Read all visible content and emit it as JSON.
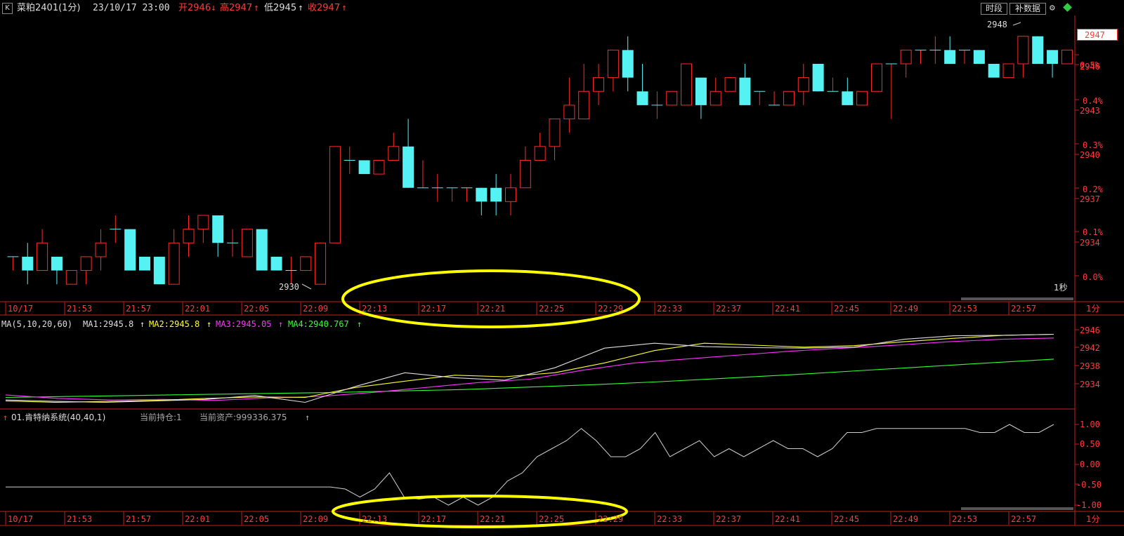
{
  "header": {
    "k_button": "K",
    "symbol": "菜粕2401(1分)",
    "datetime": "23/10/17  23:00",
    "open": "开2946",
    "open_arrow": "↓",
    "high": "高2947",
    "high_arrow": "↑",
    "low": "低2945",
    "low_arrow": "↑",
    "close": "收2947",
    "close_arrow": "↑",
    "btn_period": "时段",
    "btn_fill": "补数据"
  },
  "price_axis": {
    "price_ticks": [
      "2946",
      "2943",
      "2940",
      "2937",
      "2934"
    ],
    "pct_ticks": [
      "0.5%",
      "0.4%",
      "0.3%",
      "0.2%",
      "0.1%",
      "0.0%"
    ],
    "current_price": "2947"
  },
  "annotations": {
    "high_mark": "2948",
    "low_mark": "2930",
    "timeframe": "1秒"
  },
  "time_axis": {
    "labels": [
      "10/17",
      "21:53",
      "21:57",
      "22:01",
      "22:05",
      "22:09",
      "22:13",
      "22:17",
      "22:21",
      "22:25",
      "22:29",
      "22:33",
      "22:37",
      "22:41",
      "22:45",
      "22:49",
      "22:53",
      "22:57"
    ],
    "unit": "1分"
  },
  "ma_panel": {
    "name": "MA(5,10,20,60)",
    "ma1": "MA1:2945.8",
    "ma2": "MA2:2945.8",
    "ma3": "MA3:2945.05",
    "ma4": "MA4:2940.767",
    "arrow": "↑",
    "ticks": [
      "2946",
      "2942",
      "2938",
      "2934"
    ],
    "colors": {
      "ma1": "#dedede",
      "ma2": "#ffff33",
      "ma3": "#ff33ff",
      "ma4": "#33ff33"
    }
  },
  "system_panel": {
    "arrow": "↑",
    "name": "01.肯特纳系统(40,40,1)",
    "position": "当前持仓:1",
    "assets": "当前资产:999336.375",
    "ticks": [
      "1.00",
      "0.50",
      "0.00",
      "-0.50",
      "-1.00"
    ]
  },
  "colors": {
    "up": "#ff2a2a",
    "down": "#55f2f4",
    "axis": "#c81e1e",
    "highlight": "#ffff00"
  },
  "chart_data": {
    "type": "candlestick",
    "y_range": [
      2929.5,
      2948.8
    ],
    "candles": [
      {
        "o": 2932,
        "h": 2932,
        "l": 2931,
        "c": 2932
      },
      {
        "o": 2932,
        "h": 2933,
        "l": 2930,
        "c": 2931
      },
      {
        "o": 2931,
        "h": 2934,
        "l": 2931,
        "c": 2933
      },
      {
        "o": 2932,
        "h": 2932,
        "l": 2930,
        "c": 2931
      },
      {
        "o": 2930,
        "h": 2931,
        "l": 2930,
        "c": 2931
      },
      {
        "o": 2931,
        "h": 2932,
        "l": 2930,
        "c": 2932
      },
      {
        "o": 2932,
        "h": 2934,
        "l": 2931,
        "c": 2933
      },
      {
        "o": 2934,
        "h": 2935,
        "l": 2933,
        "c": 2934
      },
      {
        "o": 2934,
        "h": 2934,
        "l": 2931,
        "c": 2931
      },
      {
        "o": 2932,
        "h": 2932,
        "l": 2931,
        "c": 2931
      },
      {
        "o": 2932,
        "h": 2932,
        "l": 2930,
        "c": 2930
      },
      {
        "o": 2930,
        "h": 2934,
        "l": 2930,
        "c": 2933
      },
      {
        "o": 2933,
        "h": 2935,
        "l": 2932,
        "c": 2934
      },
      {
        "o": 2934,
        "h": 2935,
        "l": 2933,
        "c": 2935
      },
      {
        "o": 2935,
        "h": 2935,
        "l": 2932,
        "c": 2933
      },
      {
        "o": 2933,
        "h": 2934,
        "l": 2932,
        "c": 2933
      },
      {
        "o": 2932,
        "h": 2934,
        "l": 2932,
        "c": 2934
      },
      {
        "o": 2934,
        "h": 2934,
        "l": 2931,
        "c": 2931
      },
      {
        "o": 2932,
        "h": 2932,
        "l": 2931,
        "c": 2931
      },
      {
        "o": 2931,
        "h": 2932,
        "l": 2930,
        "c": 2931
      },
      {
        "o": 2931,
        "h": 2932,
        "l": 2931,
        "c": 2932
      },
      {
        "o": 2930,
        "h": 2933,
        "l": 2930,
        "c": 2933
      },
      {
        "o": 2933,
        "h": 2940,
        "l": 2933,
        "c": 2940
      },
      {
        "o": 2939,
        "h": 2940,
        "l": 2938,
        "c": 2939
      },
      {
        "o": 2939,
        "h": 2939,
        "l": 2938,
        "c": 2938
      },
      {
        "o": 2938,
        "h": 2939,
        "l": 2938,
        "c": 2939
      },
      {
        "o": 2939,
        "h": 2941,
        "l": 2939,
        "c": 2940
      },
      {
        "o": 2940,
        "h": 2942,
        "l": 2937,
        "c": 2937
      },
      {
        "o": 2937,
        "h": 2939,
        "l": 2937,
        "c": 2937
      },
      {
        "o": 2937,
        "h": 2938,
        "l": 2936,
        "c": 2937
      },
      {
        "o": 2937,
        "h": 2937,
        "l": 2936,
        "c": 2937
      },
      {
        "o": 2937,
        "h": 2937,
        "l": 2936,
        "c": 2937
      },
      {
        "o": 2937,
        "h": 2937,
        "l": 2935,
        "c": 2936
      },
      {
        "o": 2937,
        "h": 2938,
        "l": 2935,
        "c": 2936
      },
      {
        "o": 2936,
        "h": 2938,
        "l": 2935,
        "c": 2937
      },
      {
        "o": 2937,
        "h": 2940,
        "l": 2937,
        "c": 2939
      },
      {
        "o": 2939,
        "h": 2941,
        "l": 2939,
        "c": 2940
      },
      {
        "o": 2940,
        "h": 2942,
        "l": 2939,
        "c": 2942
      },
      {
        "o": 2942,
        "h": 2945,
        "l": 2941,
        "c": 2943
      },
      {
        "o": 2942,
        "h": 2946,
        "l": 2942,
        "c": 2944
      },
      {
        "o": 2944,
        "h": 2946,
        "l": 2943,
        "c": 2945
      },
      {
        "o": 2945,
        "h": 2947,
        "l": 2944,
        "c": 2947
      },
      {
        "o": 2947,
        "h": 2948,
        "l": 2944,
        "c": 2945
      },
      {
        "o": 2944,
        "h": 2946,
        "l": 2943,
        "c": 2943
      },
      {
        "o": 2943,
        "h": 2944,
        "l": 2942,
        "c": 2943
      },
      {
        "o": 2943,
        "h": 2944,
        "l": 2943,
        "c": 2944
      },
      {
        "o": 2943,
        "h": 2946,
        "l": 2943,
        "c": 2946
      },
      {
        "o": 2945,
        "h": 2945,
        "l": 2942,
        "c": 2943
      },
      {
        "o": 2943,
        "h": 2945,
        "l": 2943,
        "c": 2944
      },
      {
        "o": 2944,
        "h": 2945,
        "l": 2944,
        "c": 2945
      },
      {
        "o": 2945,
        "h": 2946,
        "l": 2943,
        "c": 2943
      },
      {
        "o": 2944,
        "h": 2944,
        "l": 2943,
        "c": 2944
      },
      {
        "o": 2943,
        "h": 2944,
        "l": 2943,
        "c": 2943
      },
      {
        "o": 2943,
        "h": 2944,
        "l": 2943,
        "c": 2944
      },
      {
        "o": 2944,
        "h": 2946,
        "l": 2943,
        "c": 2945
      },
      {
        "o": 2946,
        "h": 2946,
        "l": 2944,
        "c": 2944
      },
      {
        "o": 2944,
        "h": 2945,
        "l": 2944,
        "c": 2944
      },
      {
        "o": 2944,
        "h": 2945,
        "l": 2943,
        "c": 2943
      },
      {
        "o": 2943,
        "h": 2944,
        "l": 2943,
        "c": 2944
      },
      {
        "o": 2944,
        "h": 2946,
        "l": 2944,
        "c": 2946
      },
      {
        "o": 2946,
        "h": 2946,
        "l": 2942,
        "c": 2946
      },
      {
        "o": 2946,
        "h": 2947,
        "l": 2945,
        "c": 2947
      },
      {
        "o": 2947,
        "h": 2947,
        "l": 2946,
        "c": 2947
      },
      {
        "o": 2947,
        "h": 2948,
        "l": 2946,
        "c": 2947
      },
      {
        "o": 2947,
        "h": 2948,
        "l": 2946,
        "c": 2946
      },
      {
        "o": 2947,
        "h": 2947,
        "l": 2946,
        "c": 2947
      },
      {
        "o": 2947,
        "h": 2947,
        "l": 2946,
        "c": 2946
      },
      {
        "o": 2946,
        "h": 2946,
        "l": 2945,
        "c": 2945
      },
      {
        "o": 2945,
        "h": 2946,
        "l": 2945,
        "c": 2946
      },
      {
        "o": 2946,
        "h": 2946,
        "l": 2945,
        "c": 2948
      },
      {
        "o": 2948,
        "h": 2948,
        "l": 2946,
        "c": 2946
      },
      {
        "o": 2947,
        "h": 2947,
        "l": 2945,
        "c": 2946
      },
      {
        "o": 2946,
        "h": 2947,
        "l": 2946,
        "c": 2947
      }
    ],
    "ma_y_range": [
      2931.5,
      2947.3
    ],
    "ma_series": [
      {
        "key": "ma4",
        "values": [
          2933.0,
          2933.2,
          2933.4,
          2933.6,
          2933.8,
          2934.0,
          2934.3,
          2934.6,
          2935.1,
          2935.6,
          2936.2,
          2936.9,
          2937.6,
          2938.4,
          2939.2,
          2940.0,
          2940.767
        ]
      },
      {
        "key": "ma3",
        "values": [
          2933.5,
          2932.8,
          2932.5,
          2932.6,
          2932.4,
          2932.9,
          2933.2,
          2934.0,
          2935.0,
          2936.0,
          2936.7,
          2938.5,
          2940.0,
          2940.8,
          2941.6,
          2942.4,
          2943.0,
          2943.6,
          2944.3,
          2944.8,
          2945.05
        ]
      },
      {
        "key": "ma2",
        "values": [
          2932.3,
          2932.0,
          2932.2,
          2932.4,
          2932.8,
          2933.1,
          2933.0,
          2935.0,
          2936.3,
          2937.5,
          2937.2,
          2938.0,
          2940.0,
          2942.5,
          2944.0,
          2943.6,
          2943.2,
          2943.5,
          2944.3,
          2945.0,
          2945.6,
          2945.8
        ]
      },
      {
        "key": "ma1",
        "values": [
          2932.5,
          2932.2,
          2932.0,
          2932.3,
          2932.6,
          2933.4,
          2932.0,
          2935.2,
          2938.0,
          2937.0,
          2936.5,
          2939.0,
          2943.0,
          2944.0,
          2943.3,
          2943.1,
          2943.0,
          2943.2,
          2944.8,
          2945.5,
          2945.6,
          2945.8
        ]
      }
    ],
    "system_values": [
      -0.55,
      -0.55,
      -0.55,
      -0.55,
      -0.55,
      -0.55,
      -0.55,
      -0.55,
      -0.55,
      -0.55,
      -0.55,
      -0.55,
      -0.55,
      -0.55,
      -0.55,
      -0.55,
      -0.55,
      -0.55,
      -0.55,
      -0.55,
      -0.55,
      -0.55,
      -0.55,
      -0.6,
      -0.8,
      -0.6,
      -0.2,
      -0.8,
      -0.85,
      -0.8,
      -1.0,
      -0.8,
      -1.0,
      -0.8,
      -0.4,
      -0.2,
      0.2,
      0.4,
      0.6,
      0.9,
      0.6,
      0.2,
      0.2,
      0.4,
      0.8,
      0.2,
      0.4,
      0.6,
      0.2,
      0.4,
      0.2,
      0.4,
      0.6,
      0.4,
      0.4,
      0.2,
      0.4,
      0.8,
      0.8,
      0.9,
      0.9,
      0.9,
      0.9,
      0.9,
      0.9,
      0.9,
      0.8,
      0.8,
      1.0,
      0.8,
      0.8,
      1.0
    ]
  }
}
